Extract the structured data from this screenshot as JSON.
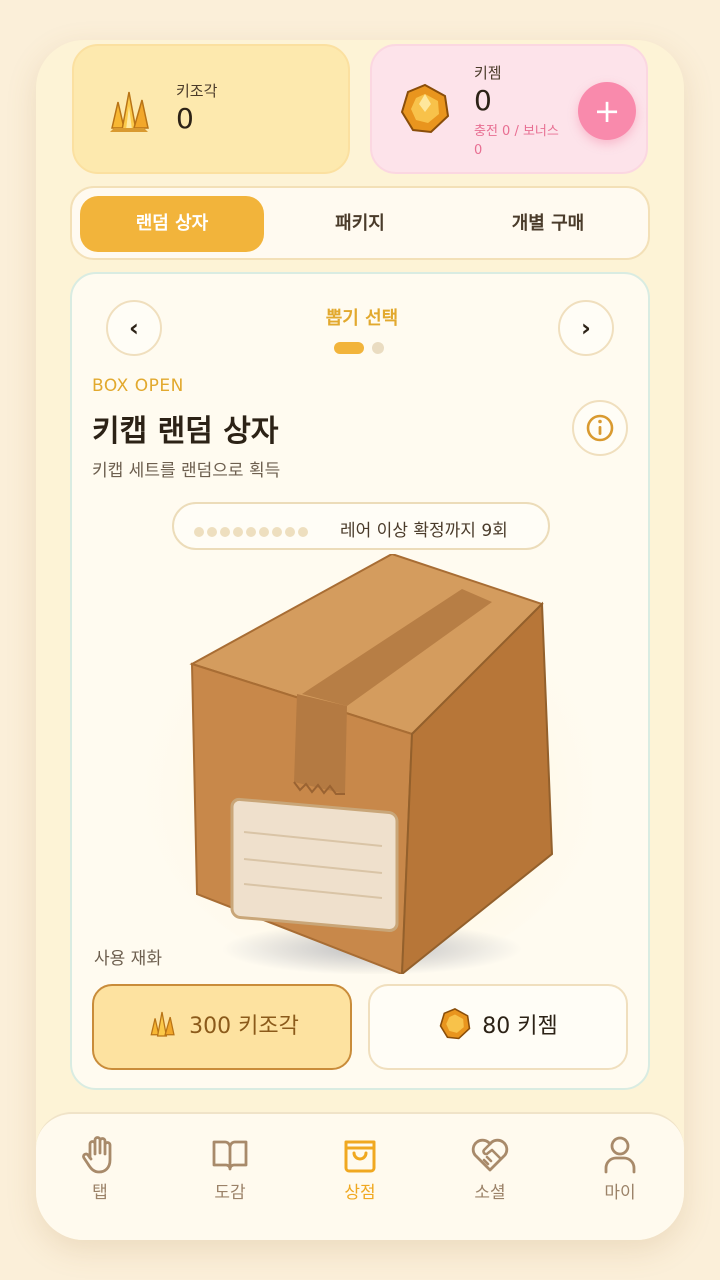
{
  "currencies": {
    "fragment": {
      "label": "키조각",
      "value": "0",
      "icon": "crystal-fragment-icon"
    },
    "gem": {
      "label": "키젬",
      "value": "0",
      "sub": "충전 0 / 보너스 0",
      "icon": "amber-gem-icon",
      "add_label": "+"
    }
  },
  "tabs": [
    {
      "label": "랜덤 상자",
      "active": true
    },
    {
      "label": "패키지",
      "active": false
    },
    {
      "label": "개별 구매",
      "active": false
    }
  ],
  "selector": {
    "title": "뽑기 선택",
    "prev": "‹",
    "next": "›",
    "page": 1,
    "pages": 2
  },
  "box": {
    "eyebrow": "BOX OPEN",
    "title": "키캡 랜덤 상자",
    "desc": "키캡 세트를 랜덤으로 획득",
    "pity_text": "레어 이상 확정까지 9회",
    "pity_dots": 9,
    "usage_label": "사용 재화"
  },
  "pay": {
    "fragment": "300 키조각",
    "gem": "80 키젬"
  },
  "bottom_nav": [
    {
      "label": "탭",
      "icon": "hand-icon",
      "active": false
    },
    {
      "label": "도감",
      "icon": "book-icon",
      "active": false
    },
    {
      "label": "상점",
      "icon": "shopping-bag-icon",
      "active": true
    },
    {
      "label": "소셜",
      "icon": "heart-handshake-icon",
      "active": false
    },
    {
      "label": "마이",
      "icon": "user-icon",
      "active": false
    }
  ],
  "colors": {
    "accent": "#f2b43b",
    "pink": "#f98aac",
    "card_bg": "#fffbf0"
  }
}
